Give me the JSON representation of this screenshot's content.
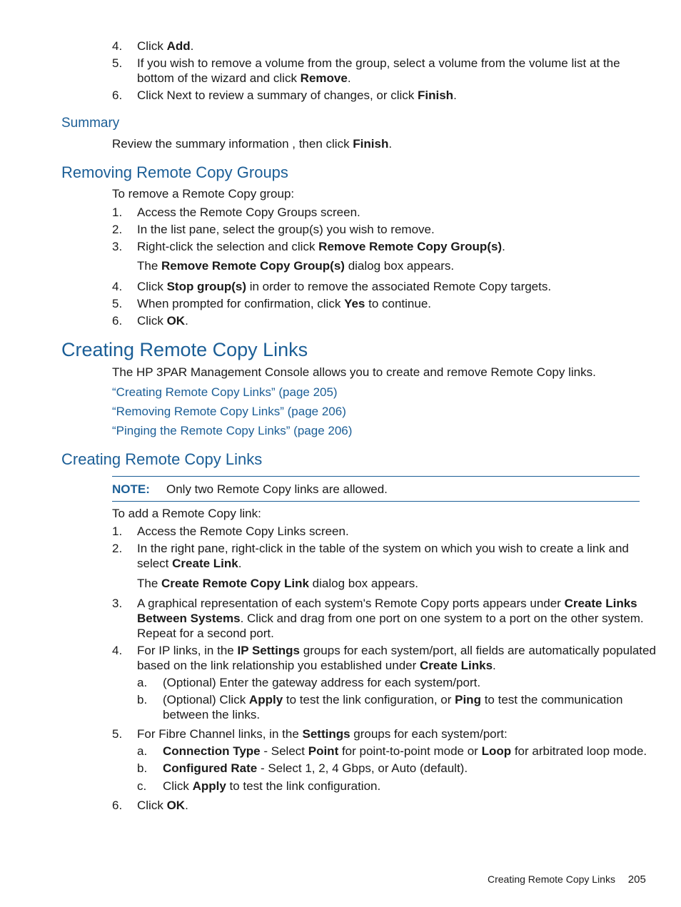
{
  "top_steps": [
    {
      "num": "4.",
      "pre": "Click ",
      "bold": "Add",
      "post": "."
    },
    {
      "num": "5.",
      "line1": "If you wish to remove a volume from the group, select a volume from the volume list at the",
      "line2_pre": "bottom of the wizard and click ",
      "line2_bold": "Remove",
      "line2_post": "."
    },
    {
      "num": "6.",
      "pre": "Click Next to review a summary of changes, or click ",
      "bold": "Finish",
      "post": "."
    }
  ],
  "summary": {
    "heading": "Summary",
    "text_pre": "Review the summary information , then click ",
    "text_bold": "Finish",
    "text_post": "."
  },
  "removing_groups": {
    "heading": "Removing Remote Copy Groups",
    "intro": "To remove a Remote Copy group:",
    "steps": [
      {
        "num": "1.",
        "text": "Access the Remote Copy Groups screen."
      },
      {
        "num": "2.",
        "text": "In the list pane, select the group(s) you wish to remove."
      },
      {
        "num": "3.",
        "pre": "Right-click the selection and click ",
        "bold": "Remove Remote Copy Group(s)",
        "post": ".",
        "note_pre": "The ",
        "note_bold": "Remove Remote Copy Group(s)",
        "note_post": " dialog box appears."
      },
      {
        "num": "4.",
        "pre": "Click ",
        "bold": "Stop group(s)",
        "post": " in order to remove the associated Remote Copy targets."
      },
      {
        "num": "5.",
        "pre": "When prompted for confirmation, click ",
        "bold": "Yes",
        "post": " to continue."
      },
      {
        "num": "6.",
        "pre": "Click ",
        "bold": "OK",
        "post": "."
      }
    ]
  },
  "creating_links_main": {
    "heading": "Creating Remote Copy Links",
    "intro": "The HP 3PAR Management Console allows you to create and remove Remote Copy links.",
    "links": [
      "“Creating Remote Copy Links” (page 205)",
      "“Removing Remote Copy Links” (page 206)",
      "“Pinging the Remote Copy Links” (page 206)"
    ]
  },
  "creating_links_sub": {
    "heading": "Creating Remote Copy Links",
    "note_label": "NOTE:",
    "note_text": "Only two Remote Copy links are allowed.",
    "intro": "To add a Remote Copy link:",
    "step1": {
      "num": "1.",
      "text": "Access the Remote Copy Links screen."
    },
    "step2": {
      "num": "2.",
      "line1": "In the right pane, right-click in the table of the system on which you wish to create a link and",
      "line2_pre": "select ",
      "line2_bold": "Create Link",
      "line2_post": ".",
      "note_pre": "The ",
      "note_bold": "Create Remote Copy Link",
      "note_post": " dialog box appears."
    },
    "step3": {
      "num": "3.",
      "line1_pre": "A graphical representation of each system's Remote Copy ports appears under ",
      "line1_bold": "Create Links",
      "line2_bold": "Between Systems",
      "line2_post": ". Click and drag from one port on one system to a port on the other system.",
      "line3": "Repeat for a second port."
    },
    "step4": {
      "num": "4.",
      "line1_pre": "For IP links, in the ",
      "line1_bold": "IP Settings",
      "line1_post": " groups for each system/port, all fields are automatically populated",
      "line2_pre": "based on the link relationship you established under ",
      "line2_bold": "Create Links",
      "line2_post": ".",
      "subs": [
        {
          "letter": "a.",
          "text": "(Optional) Enter the gateway address for each system/port."
        },
        {
          "letter": "b.",
          "pre": "(Optional) Click ",
          "bold1": "Apply",
          "mid": " to test the link configuration, or ",
          "bold2": "Ping",
          "post": " to test the communication",
          "line2": "between the links."
        }
      ]
    },
    "step5": {
      "num": "5.",
      "pre": "For Fibre Channel links, in the ",
      "bold": "Settings",
      "post": " groups for each system/port:",
      "subs": [
        {
          "letter": "a.",
          "bold1": "Connection Type",
          "mid": " - Select ",
          "bold2": "Point",
          "mid2": " for point-to-point mode or ",
          "bold3": "Loop",
          "post": " for arbitrated loop mode."
        },
        {
          "letter": "b.",
          "bold1": "Configured Rate",
          "post": " - Select 1, 2, 4 Gbps, or Auto (default)."
        },
        {
          "letter": "c.",
          "pre": "Click ",
          "bold1": "Apply",
          "post": " to test the link configuration."
        }
      ]
    },
    "step6": {
      "num": "6.",
      "pre": "Click ",
      "bold": "OK",
      "post": "."
    }
  },
  "footer": {
    "section": "Creating Remote Copy Links",
    "page": "205"
  }
}
